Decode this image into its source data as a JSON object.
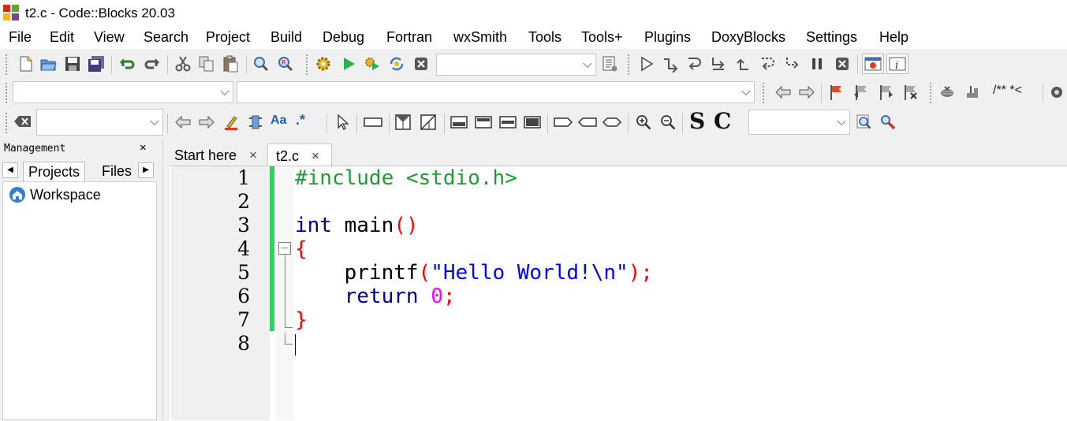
{
  "window": {
    "title": "t2.c - Code::Blocks 20.03"
  },
  "menu": [
    "File",
    "Edit",
    "View",
    "Search",
    "Project",
    "Build",
    "Debug",
    "Fortran",
    "wxSmith",
    "Tools",
    "Tools+",
    "Plugins",
    "DoxyBlocks",
    "Settings",
    "Help"
  ],
  "toolbar": {
    "doxy_comment_label": "/** *<",
    "bold_s_label": "S",
    "bold_c_label": "C",
    "regex_label": ".*",
    "case_label": "Aa"
  },
  "management": {
    "title": "Management",
    "close": "×",
    "tabs": [
      "Projects",
      "Files"
    ],
    "tree_root": "Workspace"
  },
  "editor": {
    "tabs": [
      {
        "label": "Start here",
        "close": "×"
      },
      {
        "label": "t2.c",
        "close": "×"
      }
    ],
    "line_numbers": [
      "1",
      "2",
      "3",
      "4",
      "5",
      "6",
      "7",
      "8"
    ],
    "code": {
      "l1": "#include <stdio.h>",
      "l3_kw": "int",
      "l3_fn": " main",
      "l3_paren": "()",
      "l4": "{",
      "l5_fn": "    printf",
      "l5_open": "(",
      "l5_str": "\"Hello World!\\n\"",
      "l5_close": ");",
      "l6_kw": "    return",
      "l6_num": " 0",
      "l6_semi": ";",
      "l7": "}"
    }
  },
  "colors": {
    "preprocessor": "#1e9e32",
    "keyword": "#00008b",
    "string": "#0000ff",
    "operator": "#ff0000",
    "number": "#ff00ff",
    "change_bar": "#2fd35a"
  }
}
